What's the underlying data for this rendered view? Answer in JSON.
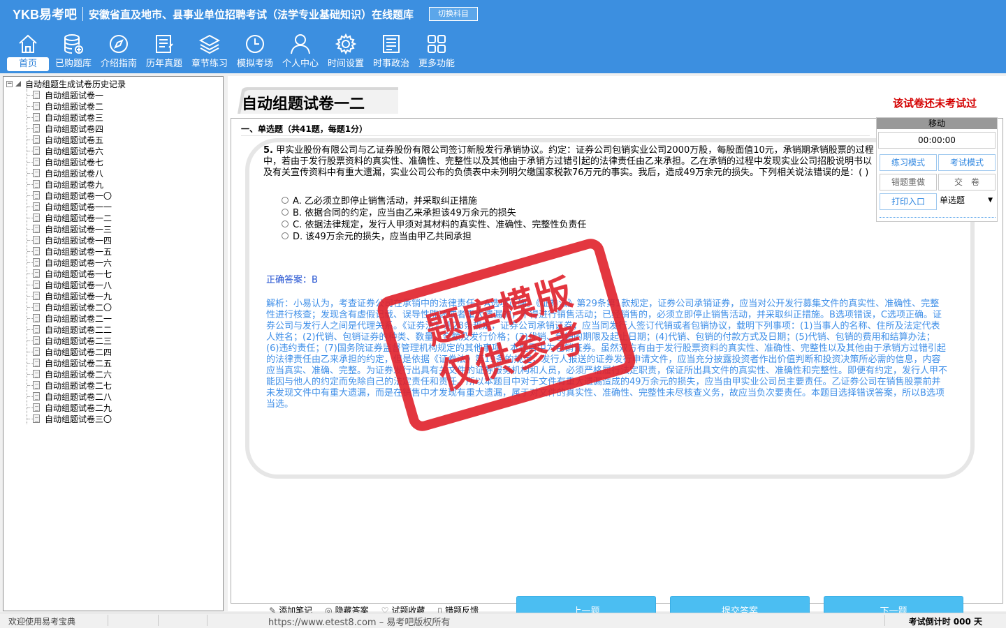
{
  "header": {
    "brand": "YKB易考吧",
    "title": "安徽省直及地市、县事业单位招聘考试（法学专业基础知识）在线题库",
    "switch_label": "切换科目"
  },
  "nav": [
    {
      "label": "首页",
      "icon": "home-icon"
    },
    {
      "label": "已购题库",
      "icon": "database-icon"
    },
    {
      "label": "介绍指南",
      "icon": "compass-icon"
    },
    {
      "label": "历年真题",
      "icon": "document-list-icon"
    },
    {
      "label": "章节练习",
      "icon": "layers-icon"
    },
    {
      "label": "模拟考场",
      "icon": "clock-icon"
    },
    {
      "label": "个人中心",
      "icon": "user-icon"
    },
    {
      "label": "时间设置",
      "icon": "gear-icon"
    },
    {
      "label": "时事政治",
      "icon": "newspaper-icon"
    },
    {
      "label": "更多功能",
      "icon": "grid-icon"
    }
  ],
  "tree": {
    "root": "自动组题生成试卷历史记录",
    "items": [
      "自动组题试卷一",
      "自动组题试卷二",
      "自动组题试卷三",
      "自动组题试卷四",
      "自动组题试卷五",
      "自动组题试卷六",
      "自动组题试卷七",
      "自动组题试卷八",
      "自动组题试卷九",
      "自动组题试卷一〇",
      "自动组题试卷一一",
      "自动组题试卷一二",
      "自动组题试卷一三",
      "自动组题试卷一四",
      "自动组题试卷一五",
      "自动组题试卷一六",
      "自动组题试卷一七",
      "自动组题试卷一八",
      "自动组题试卷一九",
      "自动组题试卷二〇",
      "自动组题试卷二一",
      "自动组题试卷二二",
      "自动组题试卷二三",
      "自动组题试卷二四",
      "自动组题试卷二五",
      "自动组题试卷二六",
      "自动组题试卷二七",
      "自动组题试卷二八",
      "自动组题试卷二九",
      "自动组题试卷三〇"
    ]
  },
  "main": {
    "paper_title": "自动组题试卷一二",
    "status": "该试卷还未考试过",
    "section": "一、单选题（共41题，每题1分）",
    "question_number": "5.",
    "question_text": "甲实业股份有限公司与乙证券股份有限公司签订新股发行承销协议。约定：证券公司包销实业公司2000万股，每股面值10元，承销期承销股票的过程中，若由于发行股票资料的真实性、准确性、完整性以及其他由于承销方过错引起的法律责任由乙来承担。乙在承销的过程中发现实业公司招股说明书以及有关宣传资料中有重大遗漏，实业公司公布的负债表中未列明欠缴国家税款76万元的事实。我后，造成49万余元的损失。下列相关说法错误的是：( )",
    "options": [
      "A. 乙必须立即停止销售活动，并采取纠正措施",
      "B. 依据合同的约定，应当由乙来承担该49万余元的损失",
      "C. 依据法律规定，发行人甲须对其材料的真实性、准确性、完整性负责任",
      "D. 该49万余元的损失，应当由甲乙共同承担"
    ],
    "answer_label": "正确答案：",
    "answer_value": "B",
    "analysis": "解析：小易认为，考查证券公司在承销中的法律责任。A选项正确。《证券法》第29条第1款规定，证券公司承销证券，应当对公开发行募集文件的真实性、准确性、完整性进行核查；发现含有虚假记载、误导性陈述或者重大遗漏的，不得进行销售活动；已经销售的，必须立即停止销售活动，并采取纠正措施。B选项错误，C选项正确。证券公司与发行人之间是代理关系。《证券法》第28条规定，证券公司承销证券，应当同发行人签订代销或者包销协议，载明下列事项：(1)当事人的名称、住所及法定代表人姓名；(2)代销、包销证券的种类、数量、金额及发行价格；(3)代销、包销的期限及起止日期；(4)代销、包销的付款方式及日期；(5)代销、包销的费用和结算办法；(6)违约责任；(7)国务院证券监督管理机构规定的其他事项。本题目中为包销证券。虽然双方有由于发行股票资料的真实性、准确性、完整性以及其他由于承销方过错引起的法律责任由乙来承担的约定，但是依据《证券法》第19条的规定，发行人报送的证券发行申请文件，应当充分披露投资者作出价值判断和投资决策所必需的信息，内容应当真实、准确、完整。为证券发行出具有关文件的证券服务机构和人员，必须严格履行法定职责，保证所出具文件的真实性、准确性和完整性。即便有约定，发行人甲不能因与他人的约定而免除自己的法定责任和责任。所以本题目中对于文件有重大遗漏造成的49万余元的损失，应当由甲实业公司员主要责任。乙证券公司在销售股票前并未发现文件中有重大遗漏，而是在销售中才发现有重大遗漏，属于对文件的真实性、准确性、完整性未尽核查义务，故应当负次要责任。本题目选择错误答案，所以B选项当选。",
    "stamp_line1": "题库模版",
    "stamp_line2": "仅供参考"
  },
  "tools": [
    {
      "label": "添加笔记",
      "icon": "pencil-icon"
    },
    {
      "label": "隐藏答案",
      "icon": "eye-icon"
    },
    {
      "label": "试题收藏",
      "icon": "heart-icon"
    },
    {
      "label": "错题反馈",
      "icon": "feedback-icon"
    }
  ],
  "buttons": {
    "prev": "上一题",
    "submit": "提交答案",
    "next": "下一题"
  },
  "panel": {
    "head": "移动",
    "time": "00:00:00",
    "practice": "练习模式",
    "exam": "考试模式",
    "redo": "错题重做",
    "hand_in": "交　卷",
    "print": "打印入口",
    "type_select": "单选题"
  },
  "statusbar": {
    "welcome": "欢迎使用易考宝典",
    "site": "https://www.etest8.com – 易考吧版权所有",
    "countdown": "考试倒计时 000 天"
  }
}
